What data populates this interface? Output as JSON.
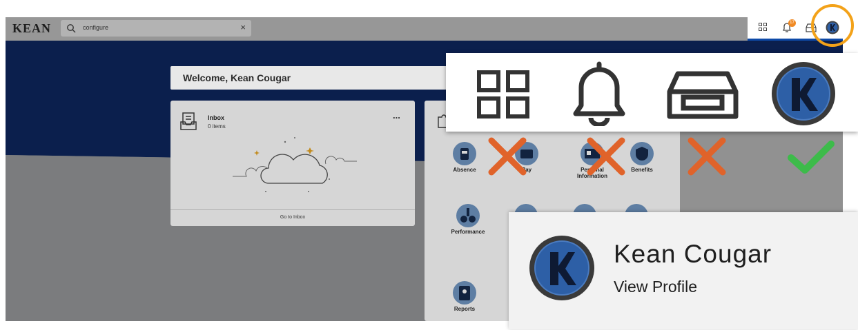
{
  "header": {
    "logo": "KEAN",
    "search": {
      "value": "configure",
      "icon": "search-icon",
      "clear_icon": "close-icon"
    },
    "clear_glyph": "×",
    "notification_count": "17",
    "icons": [
      "apps-grid-icon",
      "bell-icon",
      "inbox-tray-icon",
      "profile-avatar-icon"
    ]
  },
  "main": {
    "welcome": "Welcome, Kean Cougar",
    "inbox": {
      "title": "Inbox",
      "subtitle": "0 items",
      "menu": "...",
      "link": "Go to Inbox"
    },
    "apps": [
      {
        "label": "Absence",
        "icon": "absence-icon"
      },
      {
        "label": "Pay",
        "icon": "pay-wallet-icon"
      },
      {
        "label": "Personal Information",
        "icon": "personal-info-icon"
      },
      {
        "label": "Benefits",
        "icon": "benefits-shield-icon"
      },
      {
        "label": "Performance",
        "icon": "performance-icon"
      },
      {
        "label": "Reports",
        "icon": "reports-clipboard-icon"
      }
    ]
  },
  "callout": {
    "icons": [
      "apps-grid-icon",
      "bell-icon",
      "inbox-tray-icon",
      "profile-avatar-icon"
    ],
    "marks": [
      "wrong-x-icon",
      "wrong-x-icon",
      "wrong-x-icon",
      "correct-check-icon"
    ]
  },
  "profile_popup": {
    "name": "Kean Cougar",
    "link": "View Profile"
  },
  "colors": {
    "navy": "#0b1f4d",
    "highlight_ring": "#f3a219",
    "wrong_x": "#e0632a",
    "correct_check": "#3dbb4a"
  }
}
